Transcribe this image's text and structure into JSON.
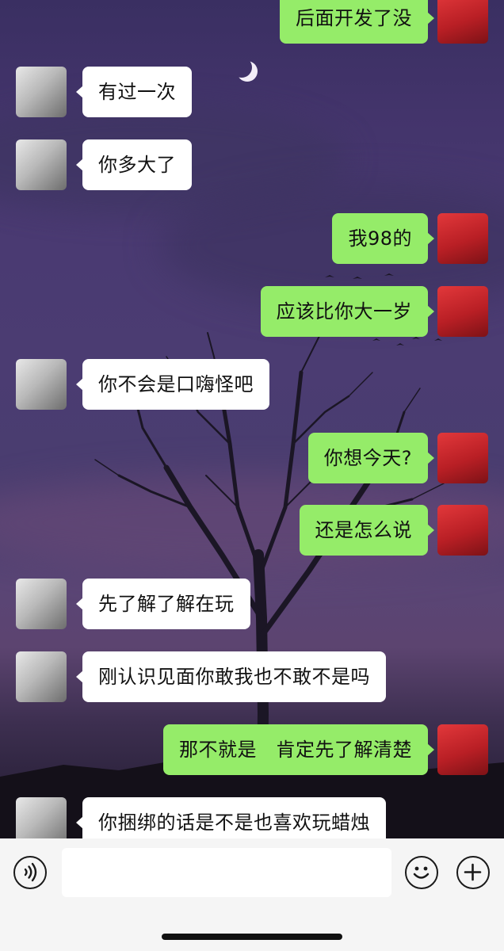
{
  "messages": [
    {
      "side": "right",
      "text": "后面开发了没"
    },
    {
      "side": "left",
      "text": "有过一次"
    },
    {
      "side": "left",
      "text": "你多大了"
    },
    {
      "side": "right",
      "text": "我98的"
    },
    {
      "side": "right",
      "text": "应该比你大一岁"
    },
    {
      "side": "left",
      "text": "你不会是口嗨怪吧"
    },
    {
      "side": "right",
      "text": "你想今天?"
    },
    {
      "side": "right",
      "text": "还是怎么说"
    },
    {
      "side": "left",
      "text": "先了解了解在玩"
    },
    {
      "side": "left",
      "text": "刚认识见面你敢我也不敢不是吗"
    },
    {
      "side": "right",
      "text": "那不就是　肯定先了解清楚"
    },
    {
      "side": "left",
      "text": "你捆绑的话是不是也喜欢玩蜡烛"
    }
  ],
  "input_bar": {
    "voice_icon": "voice-icon",
    "emoji_icon": "emoji-icon",
    "plus_icon": "plus-icon",
    "input_value": "",
    "input_placeholder": ""
  },
  "colors": {
    "right_bubble": "#95ec69",
    "left_bubble": "#ffffff",
    "input_bar": "#f5f5f5"
  }
}
